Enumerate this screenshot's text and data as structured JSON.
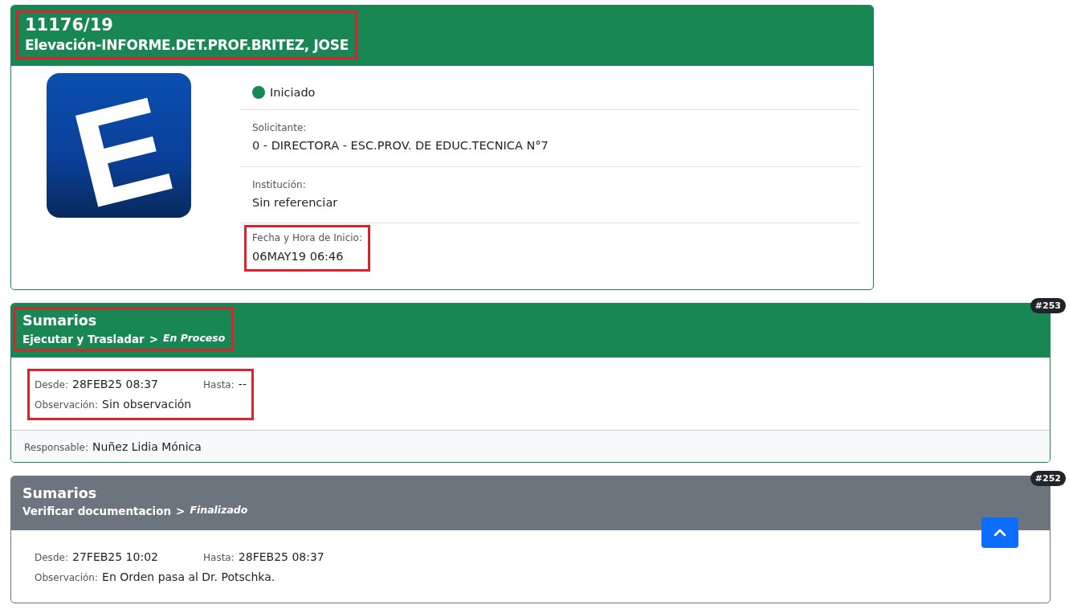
{
  "expediente": {
    "number": "11176/19",
    "title": "Elevación-INFORME.DET.PROF.BRITEZ, JOSE",
    "highlighted": true,
    "logo_letter": "E",
    "status": {
      "label": "Iniciado",
      "color": "#198754"
    },
    "fields": [
      {
        "label": "Solicitante:",
        "value": "0 - DIRECTORA - ESC.PROV. DE EDUC.TECNICA N°7",
        "highlighted": false
      },
      {
        "label": "Institución:",
        "value": "Sin referenciar",
        "highlighted": false
      },
      {
        "label": "Fecha y Hora de Inicio:",
        "value": "06MAY19 06:46",
        "highlighted": true
      }
    ]
  },
  "steps": [
    {
      "badge": "#253",
      "area": "Sumarios",
      "task": "Ejecutar y Trasladar",
      "separator": ">",
      "state": "En Proceso",
      "kind": "in_progress",
      "header_highlighted": true,
      "info_highlighted": true,
      "desde_label": "Desde:",
      "desde": "28FEB25 08:37",
      "hasta_label": "Hasta:",
      "hasta": "--",
      "obs_label": "Observación:",
      "obs": "Sin observación",
      "responsable_label": "Responsable:",
      "responsable": "Nuñez Lidia Mónica"
    },
    {
      "badge": "#252",
      "area": "Sumarios",
      "task": "Verificar documentacion",
      "separator": ">",
      "state": "Finalizado",
      "kind": "finished",
      "header_highlighted": false,
      "info_highlighted": false,
      "desde_label": "Desde:",
      "desde": "27FEB25 10:02",
      "hasta_label": "Hasta:",
      "hasta": "28FEB25 08:37",
      "obs_label": "Observación:",
      "obs": "En Orden pasa al Dr. Potschka."
    }
  ]
}
